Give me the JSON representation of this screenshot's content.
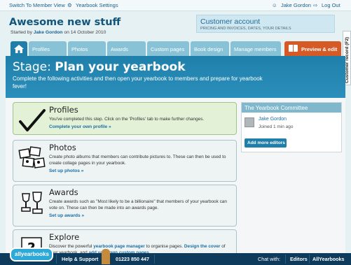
{
  "topbar": {
    "switch_view": "Switch To Member View",
    "settings": "Yearbook Settings",
    "user": "Jake Gordon",
    "logout": "Log Out"
  },
  "header": {
    "title": "Awesome new stuff",
    "started_prefix": "Started by",
    "started_by": "Jake Gordon",
    "started_suffix": "on 14 October 2010"
  },
  "account": {
    "title": "Customer account",
    "subtitle": "PRICING AND INVOICES, DATES, YOUR DETAILS"
  },
  "tabs": [
    {
      "label": "Profiles"
    },
    {
      "label": "Photos"
    },
    {
      "label": "Awards"
    },
    {
      "label": "Custom pages"
    },
    {
      "label": "Book design"
    },
    {
      "label": "Manage members"
    }
  ],
  "preview_tab": "Preview & edit",
  "side_tag": "Customer record (F2)",
  "stage": {
    "prefix": "Stage:",
    "title": "Plan your yearbook",
    "description": "Complete the following activities and then open your yearbook to members and prepare for yearbook fever!"
  },
  "steps": [
    {
      "title": "Profiles",
      "desc": "You've completed this step. Click on the 'Profiles' tab to make further changes.",
      "link": "Complete your own profile »"
    },
    {
      "title": "Photos",
      "desc": "Create photo albums that members can contribute pictures to. These can then be used to create collage pages in your yearbook.",
      "link": "Set up photos »"
    },
    {
      "title": "Awards",
      "desc": "Create awards such as \"Most likely to be a billionaire\" that members of your yearbook can vote on. These can then be made into an awards page.",
      "link": "Set up awards »"
    },
    {
      "title": "Explore",
      "desc_a": "Discover the powerful",
      "link_a": "yearbook page manager",
      "desc_b": "to organise pages.",
      "link_b": "Design the cover",
      "desc_c": "of your yearbook, and",
      "link_c": "add your own custom pages",
      "desc_d": "."
    }
  ],
  "committee": {
    "title": "The Yearbook Committee",
    "member_name": "Jake Gordon",
    "member_time": "Joined 1 min ago",
    "add_button": "Add more editors"
  },
  "bottombar": {
    "logo": "allyearbooks",
    "help": "Help & Support",
    "phone": "01223 850 447",
    "chat": "Chat with:",
    "editors": "Editors",
    "allyearbooks": "AllYearbooks"
  },
  "colors": {
    "brand_blue": "#1f7faa",
    "tab_light": "#88c2d6",
    "preview_orange": "#d65a26",
    "footer_navy": "#0e3b5c",
    "complete_green": "#e3f2d6"
  }
}
